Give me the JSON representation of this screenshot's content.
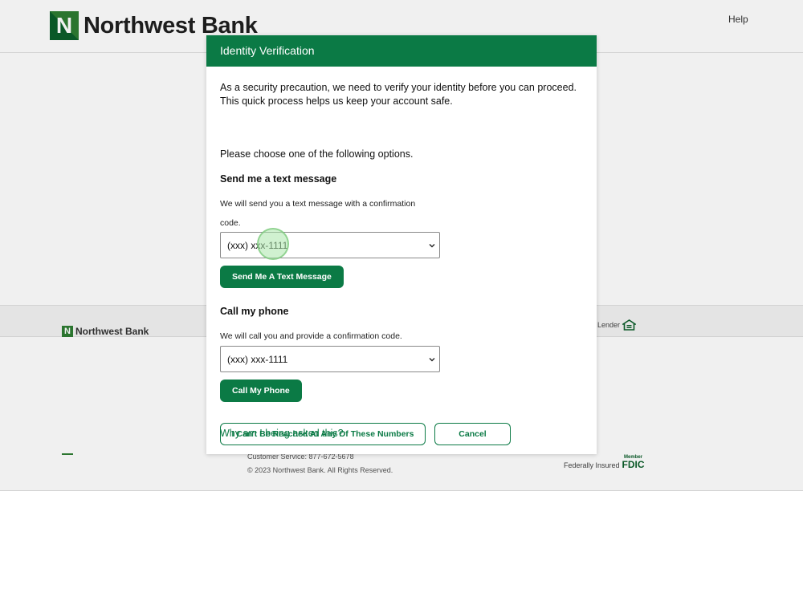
{
  "header": {
    "logo_letter": "N",
    "logo_text": "Northwest Bank",
    "help_label": "Help"
  },
  "footer": {
    "logo_letter": "N",
    "logo_text": "Northwest Bank",
    "housing_lender": "using Lender",
    "customer_service": "Customer Service: 877-672-5678",
    "copyright": "© 2023 Northwest Bank. All Rights Reserved.",
    "fdic_text": "Federally Insured",
    "fdic_member": "Member",
    "fdic_logo": "FDIC"
  },
  "modal": {
    "title": "Identity Verification",
    "intro": "As a security precaution, we need to verify your identity before you can proceed. This quick process helps us keep your account safe.",
    "choose": "Please choose one of the following options.",
    "text_section": {
      "title": "Send me a text message",
      "description": "We will send you a text message with a confirmation code.",
      "selected_number": "(xxx) xxx-1111",
      "button_label": "Send Me A Text Message"
    },
    "call_section": {
      "title": "Call my phone",
      "description": "We will call you and provide a confirmation code.",
      "selected_number": "(xxx) xxx-1111",
      "button_label": "Call My Phone"
    },
    "cant_reach_label": "I Can't Be Reached At Any Of These Numbers",
    "cancel_label": "Cancel",
    "why_link": "Why am I being asked this?"
  },
  "colors": {
    "brand_green": "#0b7a45",
    "logo_green": "#2e7d32"
  }
}
